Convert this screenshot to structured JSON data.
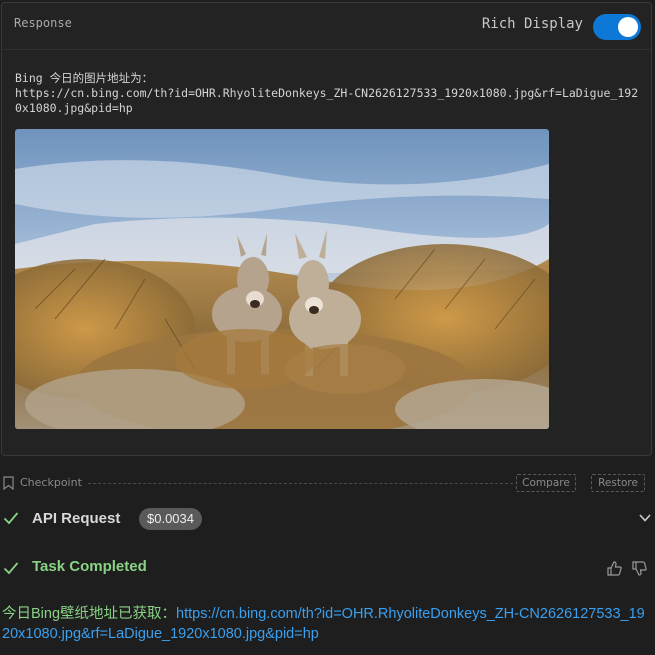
{
  "response_panel": {
    "title": "Response",
    "rich_display_label": "Rich Display",
    "rich_display_enabled": true,
    "text": "Bing 今日的图片地址为：\nhttps://cn.bing.com/th?id=OHR.RhyoliteDonkeys_ZH-CN2626127533_1920x1080.jpg&rf=LaDigue_1920x1080.jpg&pid=hp",
    "image_icon": "photo-of-two-donkeys-in-desert-brush"
  },
  "checkpoint": {
    "label": "Checkpoint",
    "compare_label": "Compare",
    "restore_label": "Restore"
  },
  "api_request": {
    "label": "API Request",
    "cost": "$0.0034",
    "status_icon": "check-icon",
    "expand_icon": "chevron-down-icon"
  },
  "task": {
    "label": "Task Completed",
    "status_icon": "check-icon",
    "feedback_icons": [
      "thumbs-up-icon",
      "thumbs-down-icon"
    ]
  },
  "final_message": {
    "prefix": "今日Bing壁纸地址已获取：",
    "link": "https://cn.bing.com/th?id=OHR.RhyoliteDonkeys_ZH-CN2626127533_1920x1080.jpg&rf=LaDigue_1920x1080.jpg&pid=hp"
  },
  "colors": {
    "background": "#1e1e1e",
    "panel": "#232323",
    "toggle_on": "#0e78d6",
    "success_green": "#89d185",
    "link_blue": "#3aa0f0",
    "badge_gray": "#5a5a5a"
  }
}
